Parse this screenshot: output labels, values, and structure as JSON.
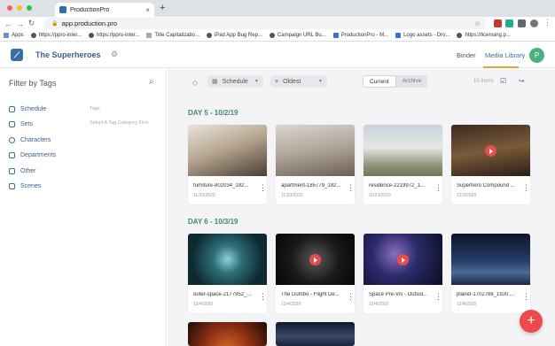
{
  "browser": {
    "tab_title": "ProductionPro",
    "tab_close": "×",
    "new_tab": "+",
    "url": "app.production.pro",
    "bookmarks": [
      {
        "label": "Apps",
        "icon": "grid"
      },
      {
        "label": "https://ppro-inter...",
        "icon": "globe"
      },
      {
        "label": "https://ppro-inter...",
        "icon": "globe"
      },
      {
        "label": "Title Capitalizatio...",
        "icon": "doc"
      },
      {
        "label": "iPad App Bug Rep...",
        "icon": "globe"
      },
      {
        "label": "Campaign URL Bu...",
        "icon": "globe"
      },
      {
        "label": "ProductionPro - M...",
        "icon": "box"
      },
      {
        "label": "Logo assets - Dro...",
        "icon": "box"
      },
      {
        "label": "https://licensing.p...",
        "icon": "globe"
      }
    ]
  },
  "header": {
    "project_name": "The Superheroes",
    "nav": {
      "binder": "Binder",
      "media_library": "Media Library"
    },
    "avatar_initial": "P",
    "colors": {
      "brand": "#3b6ea5",
      "active_underline": "#e0a33a",
      "avatar": "#4caf7d"
    }
  },
  "sidebar": {
    "title": "Filter by Tags",
    "tags_label": "Tags",
    "tags_hint": "Select A Tag Category First",
    "categories": [
      "Schedule",
      "Sets",
      "Characters",
      "Departments",
      "Other",
      "Scenes"
    ]
  },
  "toolbar": {
    "schedule_select": "Schedule",
    "sort_select": "Oldest",
    "segment": [
      "Current",
      "Archive"
    ],
    "active_segment": "Current",
    "items_count": "10 Items"
  },
  "days": [
    {
      "title": "DAY 5 - 10/2/19",
      "items": [
        {
          "name": "furniture-802034_192...",
          "date": "11/23/2020",
          "video": false
        },
        {
          "name": "apartment-185779_192...",
          "date": "11/23/2020",
          "video": false
        },
        {
          "name": "residence-2219972_1...",
          "date": "11/23/2020",
          "video": false
        },
        {
          "name": "Superhero Compound ...",
          "date": "12/3/2020",
          "video": true
        }
      ]
    },
    {
      "title": "DAY 6 - 10/3/19",
      "items": [
        {
          "name": "outer-space-2177952_...",
          "date": "12/4/2020",
          "video": false
        },
        {
          "name": "The Dumbo - Flight De...",
          "date": "12/4/2020",
          "video": true
        },
        {
          "name": "Space Pre-Vis - Outsid...",
          "date": "12/4/2020",
          "video": true
        },
        {
          "name": "planet-1702788_1920....",
          "date": "12/4/2020",
          "video": false
        }
      ]
    }
  ],
  "fab_label": "+"
}
